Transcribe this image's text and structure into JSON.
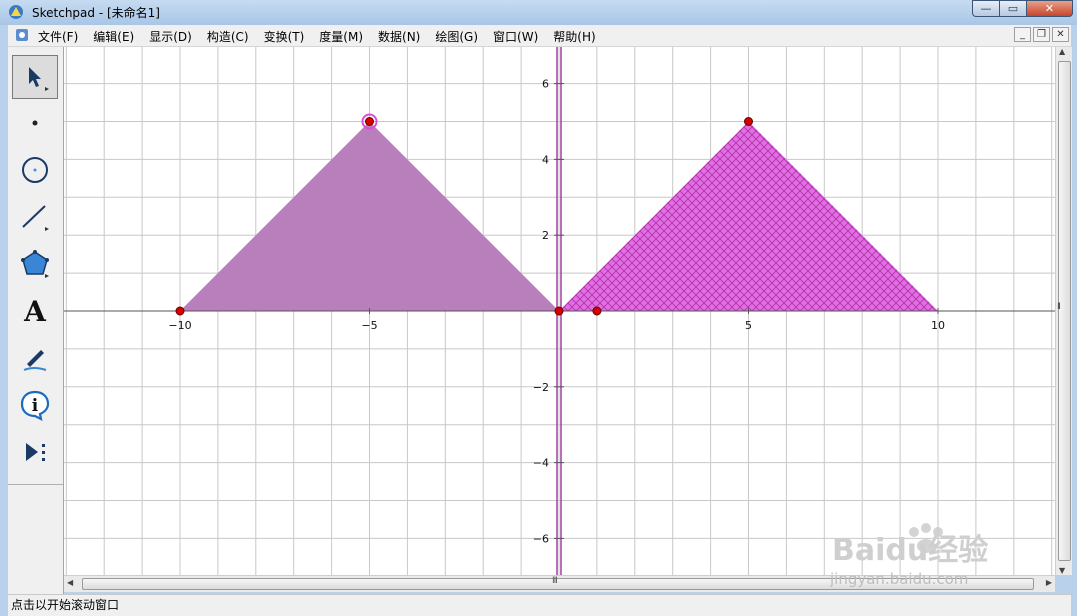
{
  "window": {
    "title": "Sketchpad  - [未命名1]",
    "buttons": {
      "minimize": "—",
      "maximize": "▭",
      "close": "✕"
    }
  },
  "menubar": {
    "items": [
      "文件(F)",
      "编辑(E)",
      "显示(D)",
      "构造(C)",
      "变换(T)",
      "度量(M)",
      "数据(N)",
      "绘图(G)",
      "窗口(W)",
      "帮助(H)"
    ],
    "doc_buttons": {
      "minimize": "_",
      "restore": "❐",
      "close": "✕"
    }
  },
  "toolbox": {
    "tools": [
      "arrow-select-icon",
      "point-icon",
      "compass-icon",
      "straightedge-icon",
      "polygon-icon",
      "text-icon",
      "marker-icon",
      "info-icon",
      "custom-tools-icon"
    ],
    "text_tool_glyph": "A",
    "info_tool_glyph": "i"
  },
  "graph": {
    "x_ticks": [
      {
        "v": -10,
        "label": "−10"
      },
      {
        "v": -5,
        "label": "−5"
      },
      {
        "v": 5,
        "label": "5"
      },
      {
        "v": 10,
        "label": "10"
      }
    ],
    "y_ticks": [
      {
        "v": 6,
        "label": "6"
      },
      {
        "v": 4,
        "label": "4"
      },
      {
        "v": 2,
        "label": "2"
      },
      {
        "v": -2,
        "label": "−2"
      },
      {
        "v": -4,
        "label": "−4"
      },
      {
        "v": -6,
        "label": "−6"
      }
    ],
    "triangle_left": [
      [
        -10,
        0
      ],
      [
        -5,
        5
      ],
      [
        0,
        0
      ]
    ],
    "triangle_right": [
      [
        0,
        0
      ],
      [
        5,
        5
      ],
      [
        10,
        0
      ]
    ],
    "points": [
      [
        -10,
        0
      ],
      [
        -5,
        5
      ],
      [
        0,
        0
      ],
      [
        1,
        0
      ],
      [
        5,
        5
      ]
    ],
    "selected_point": [
      -5,
      5
    ],
    "colors": {
      "left_fill": "#b97fbd",
      "right_fill": "#e070e0",
      "point": "#d60000",
      "axis_line": "#a040a0"
    }
  },
  "scroll": {
    "grip": "III",
    "arrow_left": "◀",
    "arrow_right": "▶",
    "arrow_up": "▲",
    "arrow_down": "▼"
  },
  "status": "点击以开始滚动窗口",
  "watermark": {
    "brand": "Baidu经验",
    "url": "jingyan.baidu.com"
  }
}
